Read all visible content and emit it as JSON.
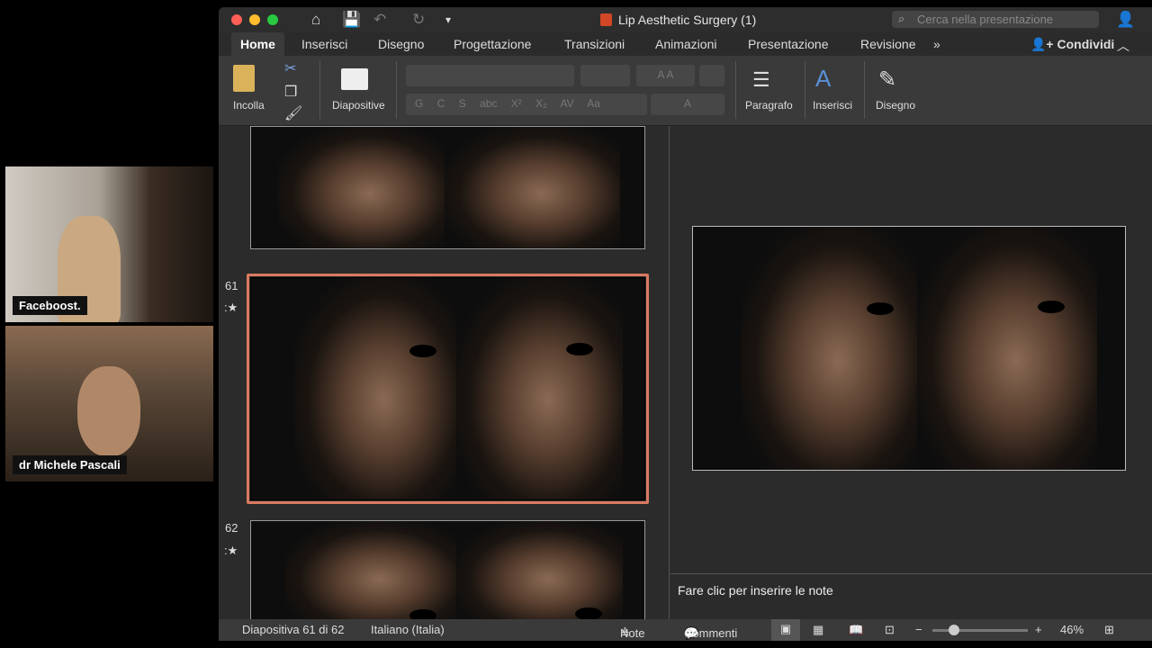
{
  "participants": [
    {
      "name": "Faceboost."
    },
    {
      "name": "dr Michele Pascali"
    }
  ],
  "window": {
    "title": "Lip Aesthetic Surgery (1)",
    "search_placeholder": "Cerca nella presentazione"
  },
  "tabs": [
    "Home",
    "Inserisci",
    "Disegno",
    "Progettazione",
    "Transizioni",
    "Animazioni",
    "Presentazione",
    "Revisione"
  ],
  "share_label": "Condividi",
  "ribbon": {
    "paste": "Incolla",
    "slides": "Diapositive",
    "paragraph": "Paragrafo",
    "insert": "Inserisci",
    "draw": "Disegno",
    "format_buttons": [
      "G",
      "C",
      "S",
      "abc",
      "X²",
      "X₂",
      "AV",
      "Aa",
      "A"
    ]
  },
  "thumbnails": [
    {
      "number": "61"
    },
    {
      "number": "62"
    }
  ],
  "notes_placeholder": "Fare clic per inserire le note",
  "status": {
    "slide_info": "Diapositiva 61 di 62",
    "language": "Italiano (Italia)",
    "notes": "Note",
    "comments": "Commenti",
    "zoom": "46%",
    "zoom_fraction": 0.46
  }
}
